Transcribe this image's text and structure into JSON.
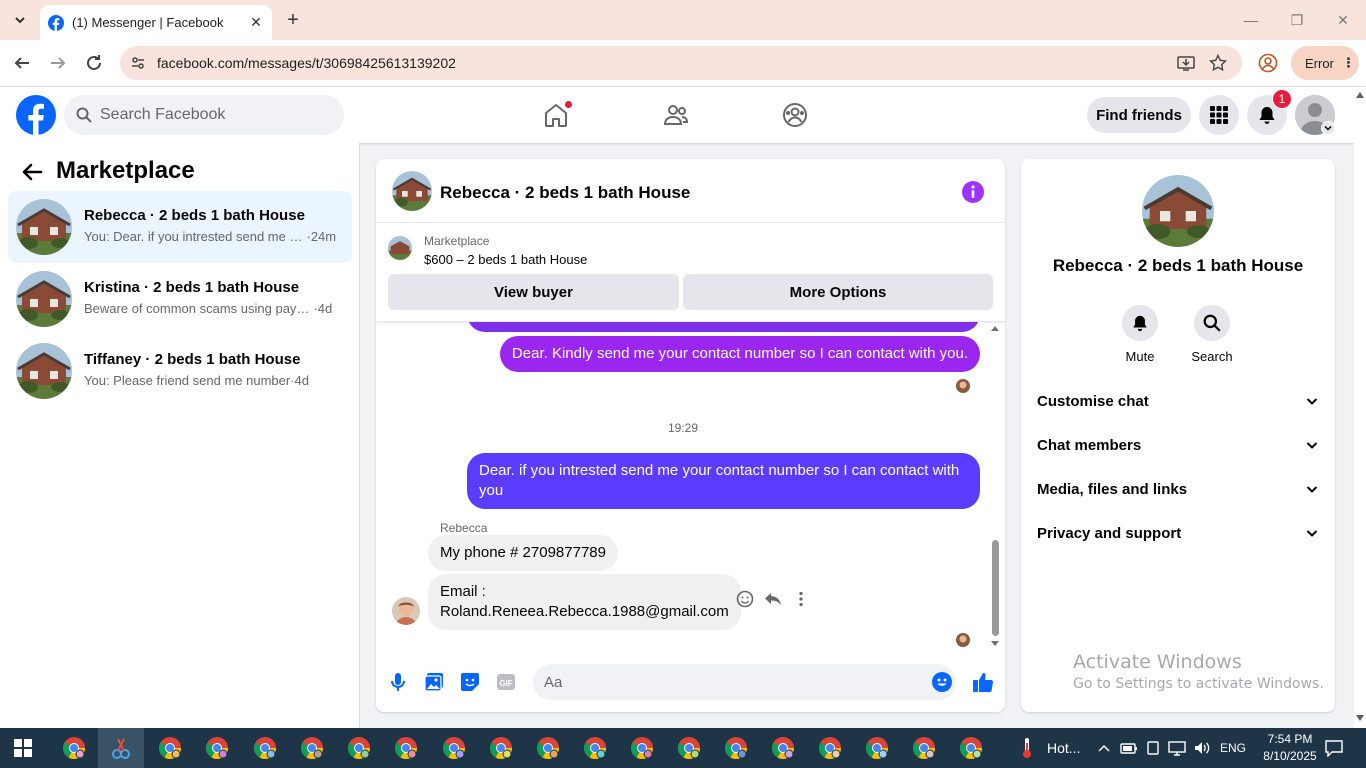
{
  "browser": {
    "tab_title": "(1) Messenger | Facebook",
    "url": "facebook.com/messages/t/30698425613139202",
    "profile_label": "Error"
  },
  "fb_header": {
    "search_placeholder": "Search Facebook",
    "find_friends": "Find friends",
    "notification_count": "1"
  },
  "sidebar": {
    "title": "Marketplace",
    "conversations": [
      {
        "name": "Rebecca · 2 beds 1 bath House",
        "preview": "You: Dear. if you intrested send me …",
        "time": "·24m",
        "active": true
      },
      {
        "name": "Kristina · 2 beds 1 bath House",
        "preview": "Beware of common scams using pay…",
        "time": "·4d",
        "active": false
      },
      {
        "name": "Tiffaney · 2 beds 1 bath House",
        "preview": "You: Please friend send me number",
        "time": "·4d",
        "active": false
      }
    ]
  },
  "chat": {
    "title": "Rebecca · 2 beds 1 bath House",
    "marketplace_label": "Marketplace",
    "listing": "$600 – 2 beds 1 bath House",
    "view_buyer": "View buyer",
    "more_options": "More Options",
    "messages": {
      "out_1": "Dear. Kindly send me your contact number so I can contact with you.",
      "timestamp": "19:29",
      "out_2_line1": "Dear. if you intrested send me your contact number so I can contact with",
      "out_2_line2": "you",
      "sender": "Rebecca",
      "in_1": "My phone # 2709877789",
      "in_2_line1": "Email :",
      "in_2_line2": "Roland.Reneea.Rebecca.1988@gmail.com"
    },
    "composer_placeholder": "Aa"
  },
  "info_panel": {
    "name": "Rebecca · 2 beds 1 bath House",
    "mute": "Mute",
    "search": "Search",
    "sections": [
      "Customise chat",
      "Chat members",
      "Media, files and links",
      "Privacy and support"
    ]
  },
  "watermark": {
    "title": "Activate Windows",
    "subtitle": "Go to Settings to activate Windows."
  },
  "taskbar": {
    "weather": "Hot...",
    "language": "ENG",
    "time": "7:54 PM",
    "date": "8/10/2025"
  },
  "colors": {
    "fb_blue": "#0866ff",
    "messenger_purple": "#a033ff",
    "messenger_violet": "#8a2be2",
    "messenger_indigo": "#5b3cff",
    "active_conv_bg": "#ebf5ff"
  }
}
